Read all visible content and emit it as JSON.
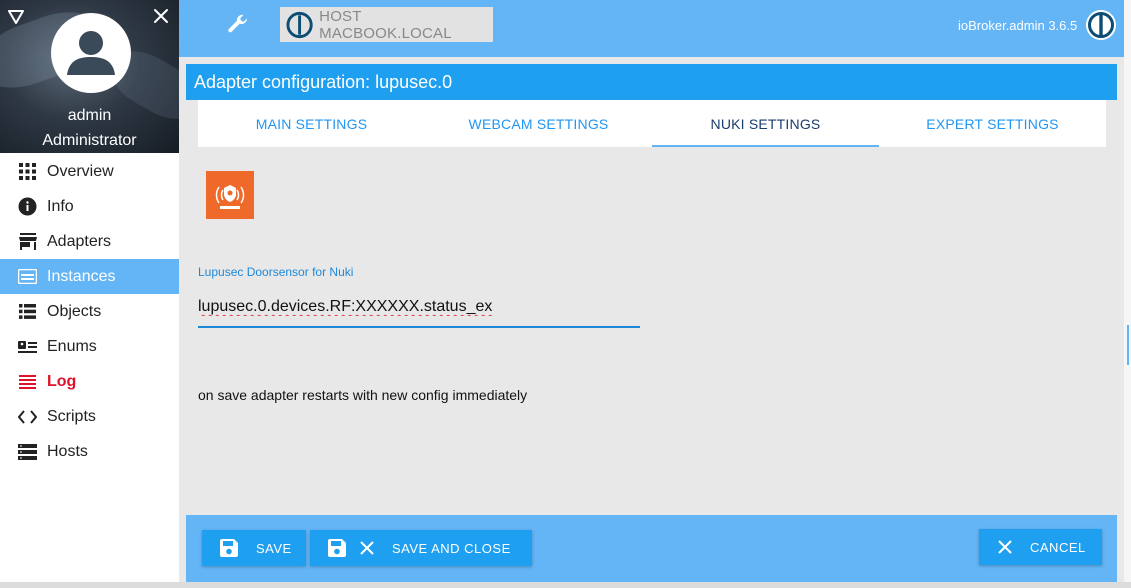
{
  "sidebar": {
    "user_name": "admin",
    "user_role": "Administrator",
    "items": [
      {
        "label": "Overview",
        "icon": "grid-icon"
      },
      {
        "label": "Info",
        "icon": "info-icon"
      },
      {
        "label": "Adapters",
        "icon": "store-icon"
      },
      {
        "label": "Instances",
        "icon": "instances-icon"
      },
      {
        "label": "Objects",
        "icon": "list-icon"
      },
      {
        "label": "Enums",
        "icon": "enums-icon"
      },
      {
        "label": "Log",
        "icon": "log-icon"
      },
      {
        "label": "Scripts",
        "icon": "code-icon"
      },
      {
        "label": "Hosts",
        "icon": "hosts-icon"
      }
    ],
    "active_item": "Instances"
  },
  "topbar": {
    "host_label": "HOST MACBOOK.LOCAL",
    "app_version": "ioBroker.admin 3.6.5"
  },
  "panel": {
    "title": "Adapter configuration: lupusec.0"
  },
  "tabs": [
    {
      "label": "MAIN SETTINGS",
      "active": false
    },
    {
      "label": "WEBCAM SETTINGS",
      "active": false
    },
    {
      "label": "NUKI SETTINGS",
      "active": true
    },
    {
      "label": "EXPERT SETTINGS",
      "active": false
    }
  ],
  "form": {
    "doorsensor_label": "Lupusec Doorsensor for Nuki",
    "doorsensor_value": "lupusec.0.devices.RF:XXXXXX.status_ex",
    "note": "on save adapter restarts with new config immediately"
  },
  "buttons": {
    "save": "SAVE",
    "save_and_close": "SAVE AND CLOSE",
    "cancel": "CANCEL"
  },
  "colors": {
    "accent": "#64b5f6",
    "panel": "#1e9fef",
    "active_tab_text": "#1a3b6e",
    "log_red": "#e0122a",
    "adapter_logo": "#ef6a2a"
  }
}
